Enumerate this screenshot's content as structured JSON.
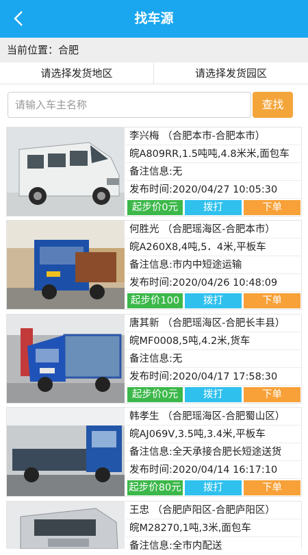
{
  "header": {
    "title": "找车源",
    "back_icon": "chevron-left-icon"
  },
  "location": {
    "label": "当前位置：合肥"
  },
  "filters": {
    "area": "请选择发货地区",
    "park": "请选择发货园区"
  },
  "search": {
    "placeholder": "请输入车主名称",
    "value": "",
    "button": "查找"
  },
  "colors": {
    "brand": "#1aa7ef",
    "search_button": "#f4a53a",
    "price_button": "#3cb84a",
    "call_button": "#2fc0ee",
    "order_button": "#f7a138"
  },
  "listings": [
    {
      "owner": "李兴梅 （合肥本市-合肥本市）",
      "vehicle": "皖A809RR,1.5吨吨,4.8米米,面包车",
      "note": "备注信息:无",
      "time": "发布时间:2020/04/27 10:05:30",
      "price": "起步价0元",
      "call": "拨打",
      "order": "下单",
      "photo": "white-van-photo"
    },
    {
      "owner": "何胜光 （合肥瑶海区-合肥本市）",
      "vehicle": "皖A260X8,4吨,5．4米,平板车",
      "note": "备注信息:市内中短途运输",
      "time": "发布时间:2020/04/26 10:48:09",
      "price": "起步价100",
      "call": "拨打",
      "order": "下单",
      "photo": "blue-flatbed-truck-photo"
    },
    {
      "owner": "唐其新 （合肥瑶海区-合肥长丰县）",
      "vehicle": "皖MF0008,5吨,4.2米,货车",
      "note": "备注信息:无",
      "time": "发布时间:2020/04/17 17:58:30",
      "price": "起步价0元",
      "call": "拨打",
      "order": "下单",
      "photo": "blue-cargo-truck-photo"
    },
    {
      "owner": "韩孝生 （合肥瑶海区-合肥蜀山区）",
      "vehicle": "皖AJ069V,3.5吨,3.4米,平板车",
      "note": "备注信息:全天承接合肥长短途送货",
      "time": "发布时间:2020/04/14 16:17:10",
      "price": "起步价80元",
      "call": "拨打",
      "order": "下单",
      "photo": "blue-light-truck-photo"
    },
    {
      "owner": "王忠 （合肥庐阳区-合肥庐阳区）",
      "vehicle": "皖M28270,1吨,3米,面包车",
      "note": "备注信息:全市内配送",
      "time": "",
      "price": "",
      "call": "",
      "order": "",
      "photo": "silver-van-photo"
    }
  ]
}
